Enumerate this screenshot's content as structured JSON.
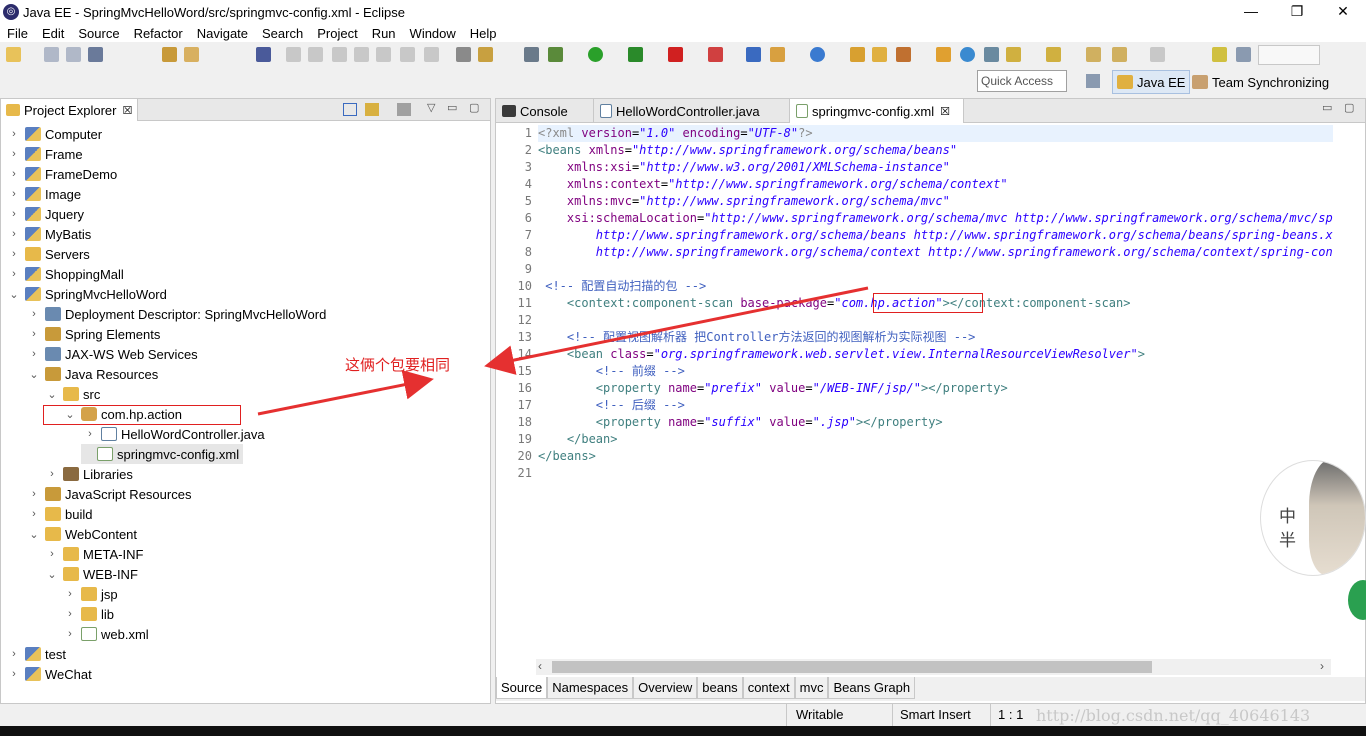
{
  "window": {
    "title": "Java EE - SpringMvcHelloWord/src/springmvc-config.xml - Eclipse",
    "minimize": "—",
    "maximize": "❐",
    "close": "✕"
  },
  "menu": [
    "File",
    "Edit",
    "Source",
    "Refactor",
    "Navigate",
    "Search",
    "Project",
    "Run",
    "Window",
    "Help"
  ],
  "toolbar2": {
    "quick_access_placeholder": "Quick Access",
    "perspectives": [
      "Java EE",
      "Team Synchronizing"
    ]
  },
  "explorer": {
    "tab_label": "Project Explorer",
    "tab_close": "☒",
    "tree": [
      {
        "label": "Computer",
        "chev": "›",
        "icon": "proj"
      },
      {
        "label": "Frame",
        "chev": "›",
        "icon": "proj"
      },
      {
        "label": "FrameDemo",
        "chev": "›",
        "icon": "proj"
      },
      {
        "label": "Image",
        "chev": "›",
        "icon": "proj"
      },
      {
        "label": "Jquery",
        "chev": "›",
        "icon": "proj"
      },
      {
        "label": "MyBatis",
        "chev": "›",
        "icon": "proj"
      },
      {
        "label": "Servers",
        "chev": "›",
        "icon": "folder"
      },
      {
        "label": "ShoppingMall",
        "chev": "›",
        "icon": "proj"
      },
      {
        "label": "SpringMvcHelloWord",
        "chev": "⌄",
        "icon": "proj"
      },
      {
        "label": "Deployment Descriptor: SpringMvcHelloWord",
        "chev": "›",
        "icon": "misc"
      },
      {
        "label": "Spring Elements",
        "chev": "›",
        "icon": "res"
      },
      {
        "label": "JAX-WS Web Services",
        "chev": "›",
        "icon": "misc"
      },
      {
        "label": "Java Resources",
        "chev": "⌄",
        "icon": "res"
      },
      {
        "label": "src",
        "chev": "⌄",
        "icon": "folder"
      },
      {
        "label": "com.hp.action",
        "chev": "⌄",
        "icon": "pkg"
      },
      {
        "label": "HelloWordController.java",
        "chev": "›",
        "icon": "java"
      },
      {
        "label": "springmvc-config.xml",
        "chev": "",
        "icon": "xml"
      },
      {
        "label": "Libraries",
        "chev": "›",
        "icon": "lib"
      },
      {
        "label": "JavaScript Resources",
        "chev": "›",
        "icon": "res"
      },
      {
        "label": "build",
        "chev": "›",
        "icon": "folder"
      },
      {
        "label": "WebContent",
        "chev": "⌄",
        "icon": "folder"
      },
      {
        "label": "META-INF",
        "chev": "›",
        "icon": "folder"
      },
      {
        "label": "WEB-INF",
        "chev": "⌄",
        "icon": "folder"
      },
      {
        "label": "jsp",
        "chev": "›",
        "icon": "folder"
      },
      {
        "label": "lib",
        "chev": "›",
        "icon": "folder"
      },
      {
        "label": "web.xml",
        "chev": "›",
        "icon": "xml"
      },
      {
        "label": "test",
        "chev": "›",
        "icon": "proj"
      },
      {
        "label": "WeChat",
        "chev": "›",
        "icon": "proj"
      }
    ]
  },
  "editor": {
    "tabs": [
      {
        "label": "Console"
      },
      {
        "label": "HelloWordController.java"
      },
      {
        "label": "springmvc-config.xml",
        "close": "☒"
      }
    ],
    "line_numbers": [
      "1",
      "2",
      "3",
      "4",
      "5",
      "6",
      "7",
      "8",
      "9",
      "10",
      "11",
      "12",
      "13",
      "14",
      "15",
      "16",
      "17",
      "18",
      "19",
      "20",
      "21"
    ],
    "bottom_tabs": [
      "Source",
      "Namespaces",
      "Overview",
      "beans",
      "context",
      "mvc",
      "Beans Graph"
    ],
    "scroll_left": "‹",
    "scroll_right": "›"
  },
  "annotation": {
    "text": "这俩个包要相同"
  },
  "status": {
    "writable": "Writable",
    "insert_mode": "Smart Insert",
    "position": "1 : 1"
  },
  "watermark": "http://blog.csdn.net/qq_40646143",
  "avatar_text": "中 半"
}
